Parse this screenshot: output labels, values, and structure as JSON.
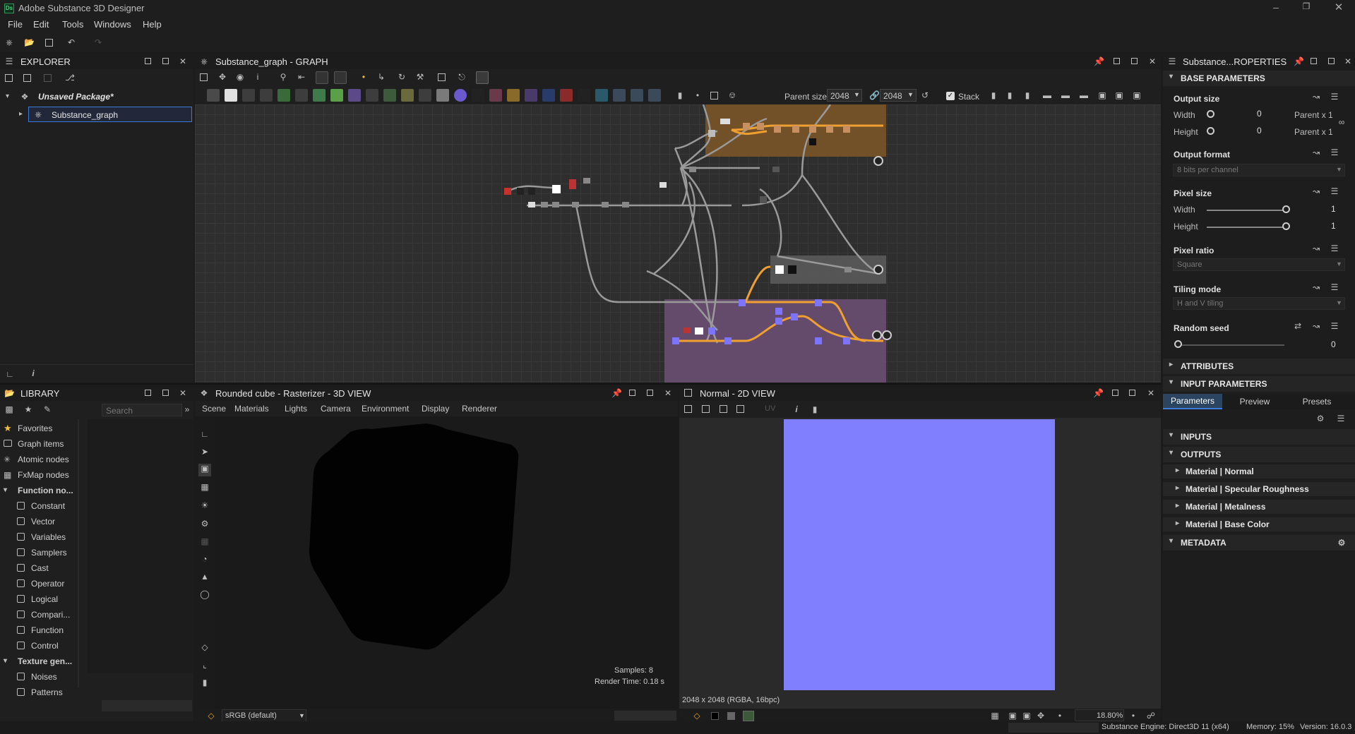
{
  "app": {
    "title": "Adobe Substance 3D Designer",
    "logo_text": "Ds"
  },
  "menu": [
    "File",
    "Edit",
    "Tools",
    "Windows",
    "Help"
  ],
  "explorer": {
    "title": "EXPLORER",
    "package": "Unsaved Package*",
    "graph_item": "Substance_graph"
  },
  "graph": {
    "title": "Substance_graph - GRAPH",
    "parent_size_label": "Parent size:",
    "size_w": "2048",
    "size_h": "2048",
    "stack_label": "Stack"
  },
  "library": {
    "title": "LIBRARY",
    "search_placeholder": "Search",
    "items": [
      "Favorites",
      "Graph items",
      "Atomic nodes",
      "FxMap nodes",
      "Function no...",
      "Constant",
      "Vector",
      "Variables",
      "Samplers",
      "Cast",
      "Operator",
      "Logical",
      "Compari...",
      "Function",
      "Control",
      "Texture gen...",
      "Noises",
      "Patterns"
    ]
  },
  "view3d": {
    "title": "Rounded cube - Rasterizer - 3D VIEW",
    "menu": [
      "Scene",
      "Materials",
      "Lights",
      "Camera",
      "Environment",
      "Display",
      "Renderer"
    ],
    "samples": "Samples: 8",
    "render_time": "Render Time: 0.18 s",
    "colorspace": "sRGB (default)"
  },
  "view2d": {
    "title": "Normal - 2D VIEW",
    "uv_label": "UV",
    "image_info": "2048 x 2048 (RGBA, 16bpc)",
    "zoom": "18.80%",
    "normal_color": "#8080ff"
  },
  "properties": {
    "title": "Substance...ROPERTIES",
    "base_params": "BASE PARAMETERS",
    "output_size": "Output size",
    "width_label": "Width",
    "height_label": "Height",
    "output_w_value": "0",
    "output_h_value": "0",
    "parent_w": "Parent x 1",
    "parent_h": "Parent x 1",
    "output_format": "Output format",
    "output_format_value": "8 bits per channel",
    "pixel_size": "Pixel size",
    "pixel_w_value": "1",
    "pixel_h_value": "1",
    "pixel_ratio": "Pixel ratio",
    "pixel_ratio_value": "Square",
    "tiling_mode": "Tiling mode",
    "tiling_value": "H and V tiling",
    "random_seed": "Random seed",
    "random_seed_value": "0",
    "attributes": "ATTRIBUTES",
    "input_params": "INPUT PARAMETERS",
    "tabs": [
      "Parameters",
      "Preview",
      "Presets"
    ],
    "inputs": "INPUTS",
    "outputs": "OUTPUTS",
    "output_items": [
      "Material | Normal",
      "Material | Specular Roughness",
      "Material | Metalness",
      "Material | Base Color"
    ],
    "metadata": "METADATA"
  },
  "status": {
    "engine": "Substance Engine: Direct3D 11 (x64)",
    "memory": "Memory: 15%",
    "version": "Version: 16.0.3"
  },
  "colors": {
    "accent": "#f0a030",
    "frame_orange": "#7a5428",
    "frame_purple": "#6a4e72",
    "frame_gray": "#5a5a5a",
    "selection": "#3a7bd5"
  }
}
